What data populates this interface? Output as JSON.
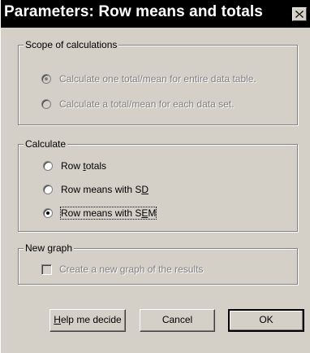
{
  "window": {
    "title": "Parameters: Row means and totals",
    "close_glyph": "close-icon"
  },
  "scope": {
    "legend": "Scope of calculations",
    "options": [
      {
        "label": "Calculate one total/mean for entire data table.",
        "selected": true,
        "enabled": false
      },
      {
        "label": "Calculate a total/mean for each data set.",
        "selected": false,
        "enabled": false
      }
    ]
  },
  "calculate": {
    "legend": "Calculate",
    "options": [
      {
        "pre": "Row ",
        "accel": "t",
        "post": "otals",
        "selected": false
      },
      {
        "pre": "Row means with S",
        "accel": "D",
        "post": "",
        "selected": false
      },
      {
        "pre": "Row means with S",
        "accel": "E",
        "post": "M",
        "selected": true
      }
    ]
  },
  "new_graph": {
    "legend": "New graph",
    "checkbox_label": "Create a new graph of the results",
    "checked": false,
    "enabled": false
  },
  "buttons": {
    "help": {
      "accel": "H",
      "rest": "elp me decide"
    },
    "cancel": "Cancel",
    "ok": "OK"
  },
  "colors": {
    "face": "#d4d0c8",
    "titlebar": "#000000",
    "disabled_text": "#808080"
  }
}
